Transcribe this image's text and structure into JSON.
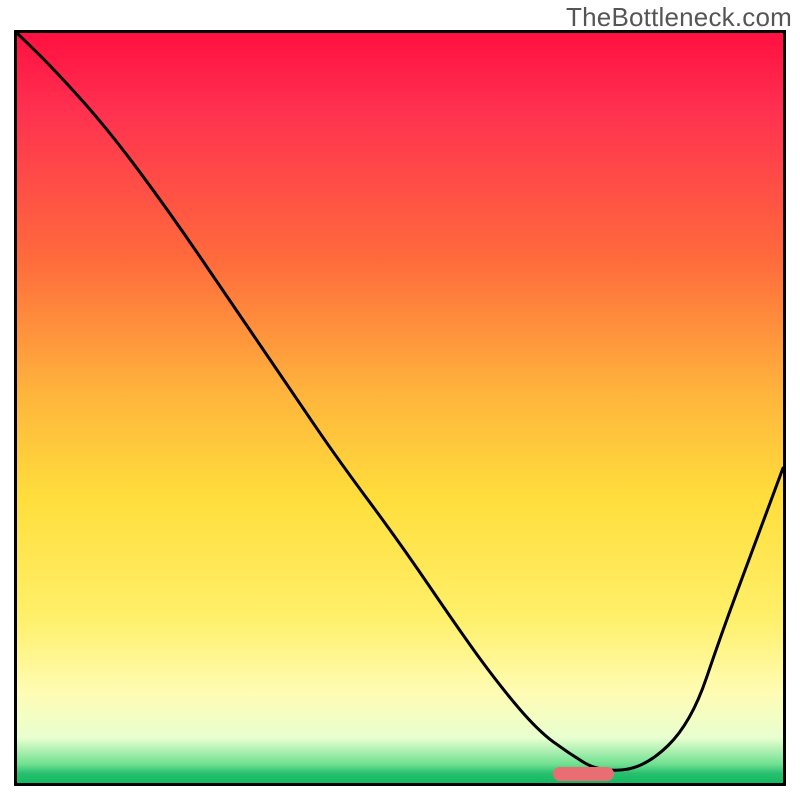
{
  "watermark": "TheBottleneck.com",
  "chart_data": {
    "type": "line",
    "title": "",
    "xlabel": "",
    "ylabel": "",
    "xlim": [
      0,
      1
    ],
    "ylim": [
      0,
      1
    ],
    "axis_ticks_visible": false,
    "grid": false,
    "background_gradient_label": "bottleneck-heatmap",
    "gradient_stops": [
      {
        "pos": 0.0,
        "color": "#ff1040"
      },
      {
        "pos": 0.1,
        "color": "#ff3050"
      },
      {
        "pos": 0.3,
        "color": "#ff6a3c"
      },
      {
        "pos": 0.48,
        "color": "#ffb43c"
      },
      {
        "pos": 0.62,
        "color": "#ffde3c"
      },
      {
        "pos": 0.78,
        "color": "#fff06a"
      },
      {
        "pos": 0.88,
        "color": "#fffcb4"
      },
      {
        "pos": 0.94,
        "color": "#e8ffd0"
      },
      {
        "pos": 0.975,
        "color": "#70e090"
      },
      {
        "pos": 0.987,
        "color": "#28c070"
      },
      {
        "pos": 1.0,
        "color": "#14b860"
      }
    ],
    "series": [
      {
        "name": "curve",
        "stroke": "#000000",
        "stroke_width": 3,
        "x": [
          0.0,
          0.05,
          0.12,
          0.2,
          0.28,
          0.36,
          0.42,
          0.5,
          0.58,
          0.63,
          0.68,
          0.72,
          0.76,
          0.82,
          0.88,
          0.92,
          0.96,
          1.0
        ],
        "y": [
          1.0,
          0.95,
          0.87,
          0.76,
          0.64,
          0.52,
          0.43,
          0.32,
          0.2,
          0.13,
          0.07,
          0.04,
          0.015,
          0.02,
          0.08,
          0.2,
          0.31,
          0.42
        ]
      }
    ],
    "marker": {
      "label": "optimal-zone",
      "color": "#e86e74",
      "x_start": 0.7,
      "x_end": 0.78,
      "y": 0.005
    }
  }
}
